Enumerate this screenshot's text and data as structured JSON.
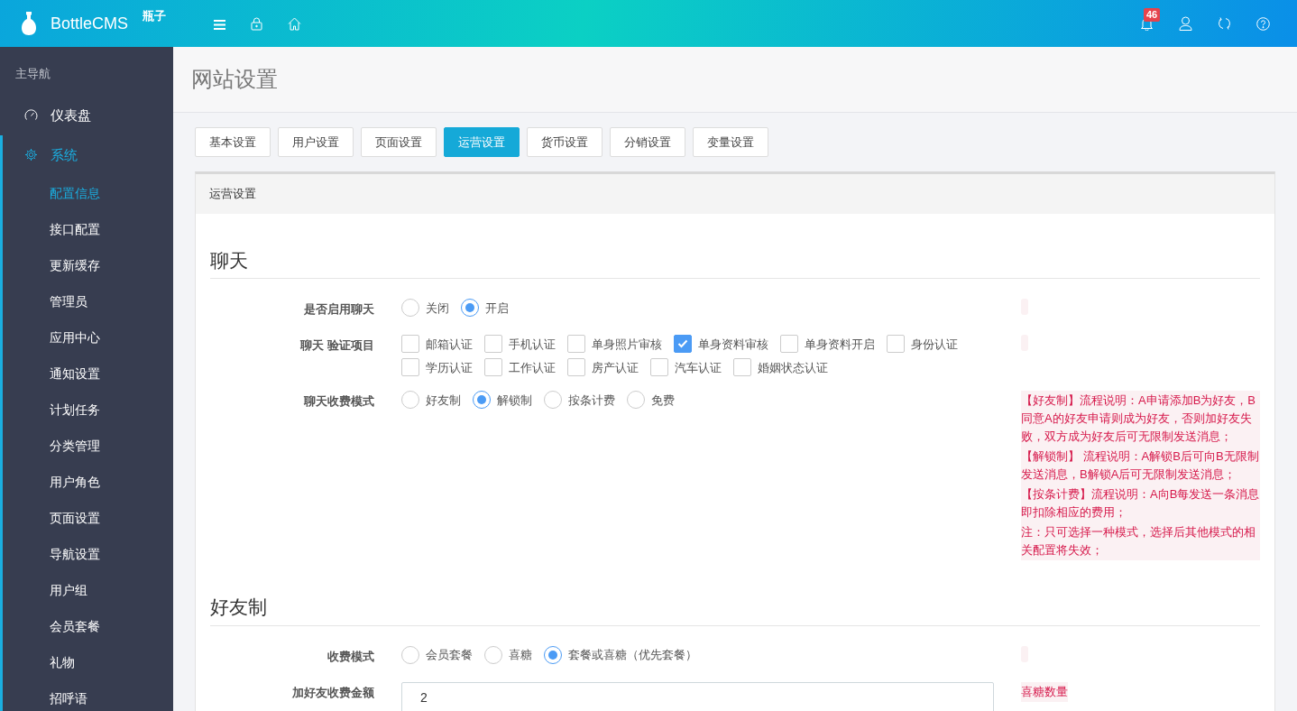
{
  "brand": {
    "name": "BottleCMS",
    "tag": "瓶子"
  },
  "topbar": {
    "notifications": "46"
  },
  "sidebar": {
    "heading": "主导航",
    "items": [
      {
        "label": "仪表盘",
        "selected": false
      },
      {
        "label": "系统",
        "selected": true,
        "expanded": true,
        "children": [
          {
            "label": "配置信息",
            "selected": true
          },
          {
            "label": "接口配置",
            "selected": false
          },
          {
            "label": "更新缓存",
            "selected": false
          },
          {
            "label": "管理员",
            "selected": false
          },
          {
            "label": "应用中心",
            "selected": false
          },
          {
            "label": "通知设置",
            "selected": false
          },
          {
            "label": "计划任务",
            "selected": false
          },
          {
            "label": "分类管理",
            "selected": false
          },
          {
            "label": "用户角色",
            "selected": false
          },
          {
            "label": "页面设置",
            "selected": false
          },
          {
            "label": "导航设置",
            "selected": false
          },
          {
            "label": "用户组",
            "selected": false
          },
          {
            "label": "会员套餐",
            "selected": false
          },
          {
            "label": "礼物",
            "selected": false
          },
          {
            "label": "招呼语",
            "selected": false
          }
        ]
      }
    ]
  },
  "page_title": "网站设置",
  "tabs": [
    {
      "label": "基本设置",
      "selected": false
    },
    {
      "label": "用户设置",
      "selected": false
    },
    {
      "label": "页面设置",
      "selected": false
    },
    {
      "label": "运营设置",
      "selected": true
    },
    {
      "label": "货币设置",
      "selected": false
    },
    {
      "label": "分销设置",
      "selected": false
    },
    {
      "label": "变量设置",
      "selected": false
    }
  ],
  "card": {
    "title": "运营设置",
    "sections": [
      {
        "title": "聊天",
        "fields": [
          {
            "label": "是否启用聊天",
            "kind": "radio",
            "options": [
              {
                "label": "关闭",
                "selected": false
              },
              {
                "label": "开启",
                "selected": true
              }
            ]
          },
          {
            "label": "聊天 验证项目",
            "kind": "checkbox",
            "options": [
              {
                "label": "邮箱认证",
                "checked": false
              },
              {
                "label": "手机认证",
                "checked": false
              },
              {
                "label": "单身照片审核",
                "checked": false
              },
              {
                "label": "单身资料审核",
                "checked": true
              },
              {
                "label": "单身资料开启",
                "checked": false
              },
              {
                "label": "身份认证",
                "checked": false
              },
              {
                "label": "学历认证",
                "checked": false
              },
              {
                "label": "工作认证",
                "checked": false
              },
              {
                "label": "房产认证",
                "checked": false
              },
              {
                "label": "汽车认证",
                "checked": false
              },
              {
                "label": "婚姻状态认证",
                "checked": false
              }
            ]
          },
          {
            "label": "聊天收费模式",
            "kind": "radio",
            "options": [
              {
                "label": "好友制",
                "selected": false
              },
              {
                "label": "解锁制",
                "selected": true
              },
              {
                "label": "按条计费",
                "selected": false
              },
              {
                "label": "免费",
                "selected": false
              }
            ],
            "hint_lines": [
              "【好友制】流程说明：A申请添加B为好友，B同意A的好友申请则成为好友，否则加好友失败，双方成为好友后可无限制发送消息；",
              "【解锁制】  流程说明：A解锁B后可向B无限制发送消息，B解锁A后可无限制发送消息；",
              "【按条计费】流程说明：A向B每发送一条消息即扣除相应的费用；",
              "注：只可选择一种模式，选择后其他模式的相关配置将失效；"
            ]
          }
        ]
      },
      {
        "title": "好友制",
        "fields": [
          {
            "label": "收费模式",
            "kind": "radio",
            "options": [
              {
                "label": "会员套餐",
                "selected": false
              },
              {
                "label": "喜糖",
                "selected": false
              },
              {
                "label": "套餐或喜糖（优先套餐）",
                "selected": true
              }
            ]
          },
          {
            "label": "加好友收费金额",
            "kind": "text",
            "value": "2",
            "hint_lines": [
              "喜糖数量"
            ]
          }
        ]
      }
    ]
  }
}
